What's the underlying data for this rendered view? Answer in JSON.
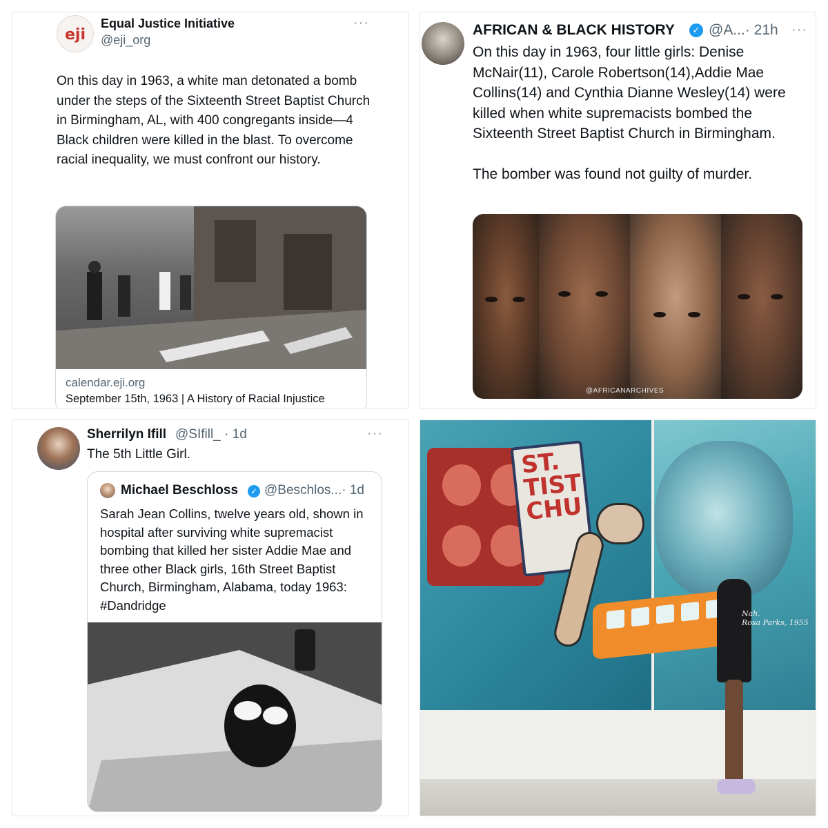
{
  "panel1": {
    "name": "Equal Justice Initiative",
    "handle": "@eji_org",
    "logo_text": "eji",
    "more": "···",
    "text": "On this day in 1963, a white man detonated a bomb under the steps of the Sixteenth Street Baptist Church in Birmingham, AL, with 400 congregants inside—4 Black children were killed in the blast. To overcome racial inequality, we must confront our history.",
    "card": {
      "domain": "calendar.eji.org",
      "title": "September 15th, 1963 | A History of Racial Injustice"
    }
  },
  "panel2": {
    "name": "AFRICAN & BLACK HISTORY",
    "handle": "@A...",
    "time": "· 21h",
    "more": "···",
    "text1": "On this day in 1963, four little girls: Denise McNair(11), Carole Robertson(14),Addie Mae Collins(14) and Cynthia Dianne Wesley(14) were killed when white supremacists bombed the Sixteenth Street Baptist Church in Birmingham.",
    "text2": "The bomber was found not guilty of murder.",
    "watermark": "@AFRICANARCHIVES"
  },
  "panel3": {
    "name": "Sherrilyn Ifill",
    "handle": "@SIfill_",
    "time": "· 1d",
    "more": "···",
    "text": "The 5th Little Girl.",
    "quote": {
      "name": "Michael Beschloss",
      "handle": "@Beschlos...",
      "time": "· 1d",
      "text": "Sarah Jean Collins, twelve years old, shown in hospital after surviving white supremacist bombing that killed her sister Addie Mae and three other Black girls, 16th Street Baptist Church, Birmingham, Alabama, today 1963:",
      "hashtag": "#Dandridge"
    }
  },
  "panel4": {
    "sign_text": "ST.\nTIST\nCHU",
    "shirt_text": "Nah.\nRosa Parks, 1955"
  },
  "colors": {
    "verified": "#1d9bf0",
    "text": "#0f1419",
    "muted": "#536471",
    "eji_red": "#c8332b"
  }
}
